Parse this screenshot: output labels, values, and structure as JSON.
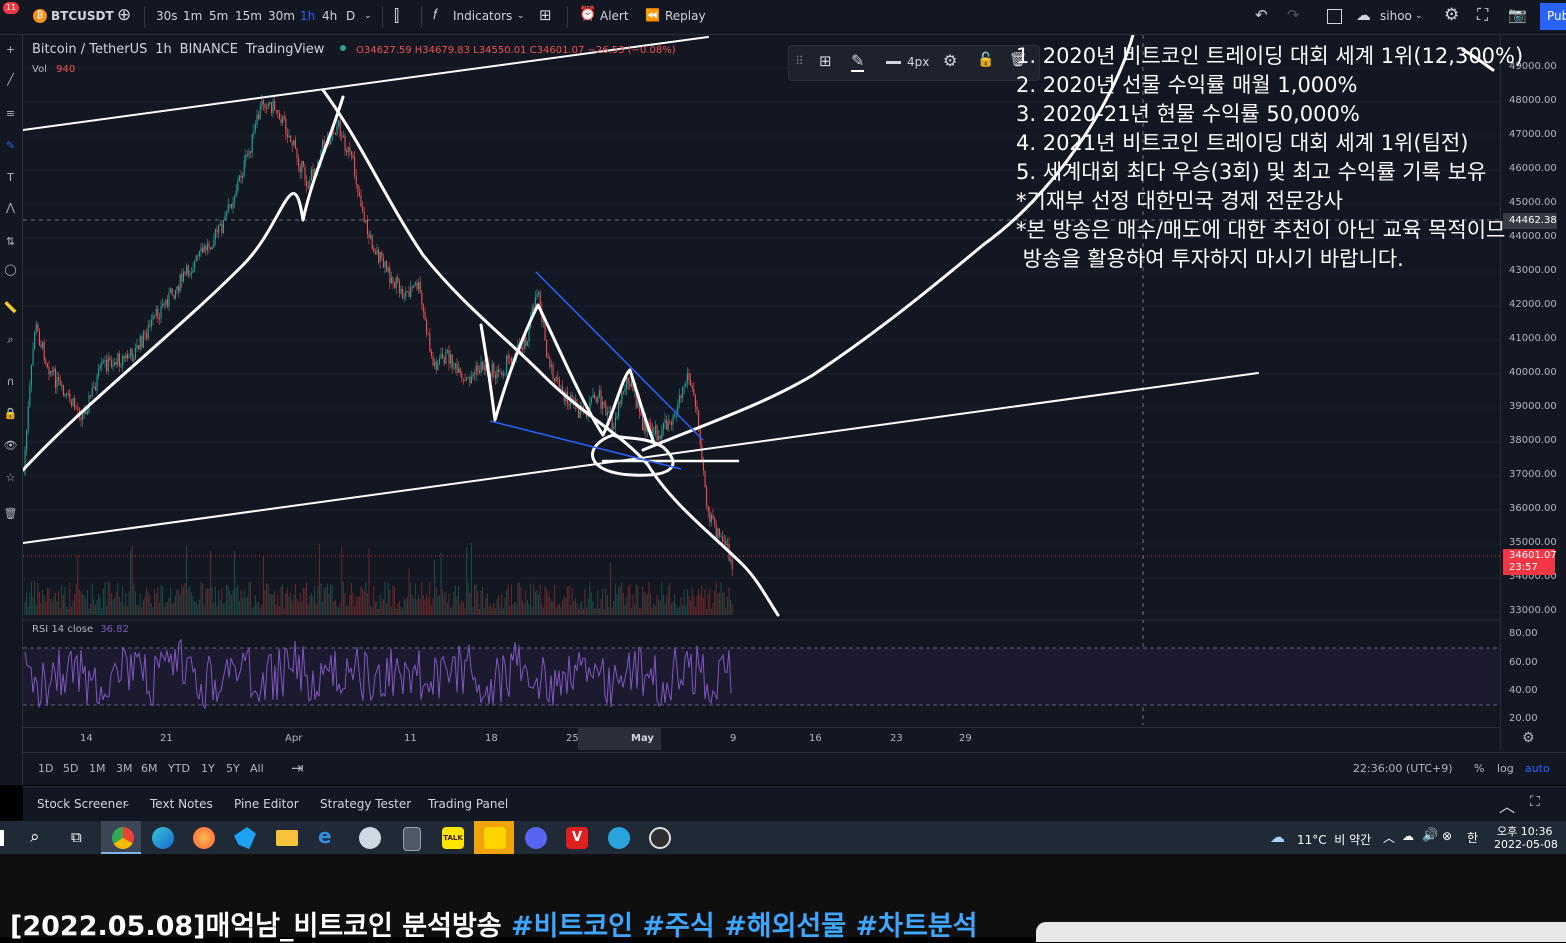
{
  "topbar": {
    "symbol": "BTCUSDT",
    "notification_count": "11",
    "intervals": [
      "30s",
      "1m",
      "5m",
      "15m",
      "30m",
      "1h",
      "4h",
      "D"
    ],
    "active_interval": "1h",
    "indicators_label": "Indicators",
    "alert_label": "Alert",
    "replay_label": "Replay",
    "user_label": "sihoo",
    "publish_label": "Pub"
  },
  "legend": {
    "title": "Bitcoin / TetherUS",
    "interval": "1h",
    "exchange": "BINANCE",
    "source": "TradingView",
    "ohlc": "O34627.59 H34679.83 L34550.01 C34601.07 −26.53 (−0.08%)",
    "vol_label": "Vol",
    "vol_value": "940"
  },
  "drawbar": {
    "width_label": "4px"
  },
  "price_axis": {
    "labels": [
      "49000.00",
      "48000.00",
      "47000.00",
      "46000.00",
      "45000.00",
      "44000.00",
      "43000.00",
      "42000.00",
      "41000.00",
      "40000.00",
      "39000.00",
      "38000.00",
      "37000.00",
      "36000.00",
      "35000.00",
      "34000.00",
      "33000.00"
    ],
    "crosshair_price": "44462.38",
    "last_price": "34601.07",
    "countdown": "23:57"
  },
  "rsi": {
    "label": "RSI",
    "params": "14 close",
    "value": "36.82",
    "axis_labels": [
      "80.00",
      "60.00",
      "40.00",
      "20.00"
    ]
  },
  "time_axis": {
    "labels": [
      "14",
      "21",
      "Apr",
      "11",
      "18",
      "25",
      "May",
      "9",
      "16",
      "23",
      "29"
    ],
    "highlight": "May"
  },
  "overlay_text": [
    "1. 2020년 비트코인 트레이딩 대회 세계 1위(12,300%)",
    "2. 2020년 선물 수익률 매월 1,000%",
    "3. 2020-21년 현물 수익률 50,000%",
    "4. 2021년 비트코인 트레이딩 대회 세계 1위(팀전)",
    "5. 세계대회 최다 우승(3회) 및 최고 수익률 기록 보유",
    "*기재부 선정 대한민국 경제 전문강사",
    "*본 방송은 매수/매도에 대한 추천이 아닌 교육 목적이므",
    " 방송을 활용하여 투자하지 마시기 바랍니다."
  ],
  "range_bar": {
    "ranges": [
      "1D",
      "5D",
      "1M",
      "3M",
      "6M",
      "YTD",
      "1Y",
      "5Y",
      "All"
    ],
    "clock": "22:36:00 (UTC+9)",
    "percent_label": "%",
    "log_label": "log",
    "auto_label": "auto"
  },
  "panel_tabs": [
    "Stock Screener",
    "Text Notes",
    "Pine Editor",
    "Strategy Tester",
    "Trading Panel"
  ],
  "taskbar": {
    "weather": "11°C  비 약간",
    "ampm": "오후 10:36",
    "date": "2022-05-08",
    "ime": "한"
  },
  "video_title": {
    "main": "[2022.05.08]매억남_비트코인 분석방송 ",
    "tags": "#비트코인 #주식 #해외선물 #차트분석"
  },
  "colors": {
    "bg": "#131722",
    "up": "#26a69a",
    "down": "#ef5350",
    "accent": "#2962ff",
    "rsi": "#7e57c2",
    "price_tag": "#f23645"
  }
}
